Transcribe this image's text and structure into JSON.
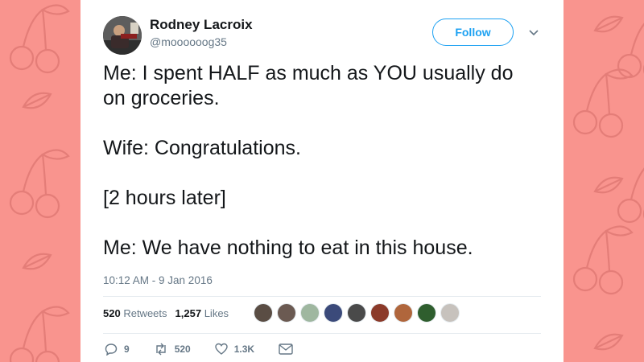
{
  "background": {
    "color": "#f9948e",
    "motif": "cherry-icon",
    "motif_color": "#e47d78"
  },
  "tweet": {
    "author_name": "Rodney Lacroix",
    "author_handle": "@moooooog35",
    "follow_label": "Follow",
    "lines": [
      "Me: I spent HALF as much as YOU usually do on groceries.",
      "Wife: Congratulations.",
      "[2 hours later]",
      "Me: We have nothing to eat in this house."
    ],
    "timestamp": "10:12 AM - 9 Jan 2016",
    "retweets_count": "520",
    "retweets_label": "Retweets",
    "likes_count": "1,257",
    "likes_label": "Likes",
    "liker_avatar_colors": [
      "#5a4d44",
      "#6b5a52",
      "#9fb7a0",
      "#3b4a7a",
      "#4a4a4a",
      "#8b3a2a",
      "#b0663c",
      "#2f5e2e",
      "#c7c2bd"
    ],
    "actions": {
      "reply_count": "9",
      "retweet_count": "520",
      "like_count": "1.3K"
    },
    "accent_color": "#1da1f2"
  }
}
